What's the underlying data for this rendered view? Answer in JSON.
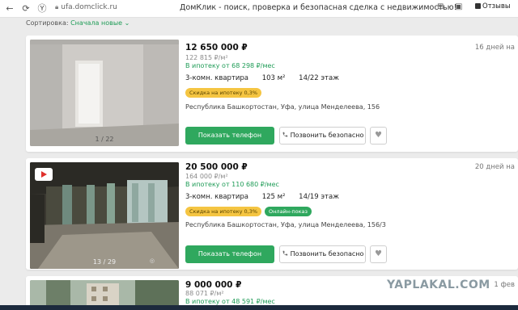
{
  "browser": {
    "url": "ufa.domclick.ru",
    "tab_title": "ДомКлик - поиск, проверка и безопасная сделка с недвижимостью!",
    "feedback_label": "Отзывы"
  },
  "sort": {
    "label": "Сортировка:",
    "value": "Сначала новые"
  },
  "listings": [
    {
      "price": "12 650 000 ₽",
      "price_per_m2": "122 815 ₽/м²",
      "mortgage": "В ипотеку от 68 298 ₽/мес",
      "rooms": "3-комн. квартира",
      "area": "103 м²",
      "floor": "14/22 этаж",
      "badges": [
        "Скидка на ипотеку 0,3%"
      ],
      "address": "Республика Башкортостан, Уфа, улица Менделеева, 156",
      "photo_counter": "1 / 22",
      "date": "16 дней на"
    },
    {
      "price": "20 500 000 ₽",
      "price_per_m2": "164 000 ₽/м²",
      "mortgage": "В ипотеку от 110 680 ₽/мес",
      "rooms": "3-комн. квартира",
      "area": "125 м²",
      "floor": "14/19 этаж",
      "badges": [
        "Скидка на ипотеку 0,3%",
        "Онлайн-показ"
      ],
      "address": "Республика Башкортостан, Уфа, улица Менделеева, 156/3",
      "photo_counter": "13 / 29",
      "date": "20 дней на"
    },
    {
      "price": "9 000 000 ₽",
      "price_per_m2": "88 071 ₽/м²",
      "mortgage": "В ипотеку от 48 591 ₽/мес",
      "date": "1 фев"
    }
  ],
  "actions": {
    "show_phone": "Показать телефон",
    "call_free": "Позвонить безопасно"
  },
  "watermark": "YAPLAKAL.COM",
  "colors": {
    "accent_green": "#2fa85e",
    "badge_yellow": "#f5c542"
  }
}
